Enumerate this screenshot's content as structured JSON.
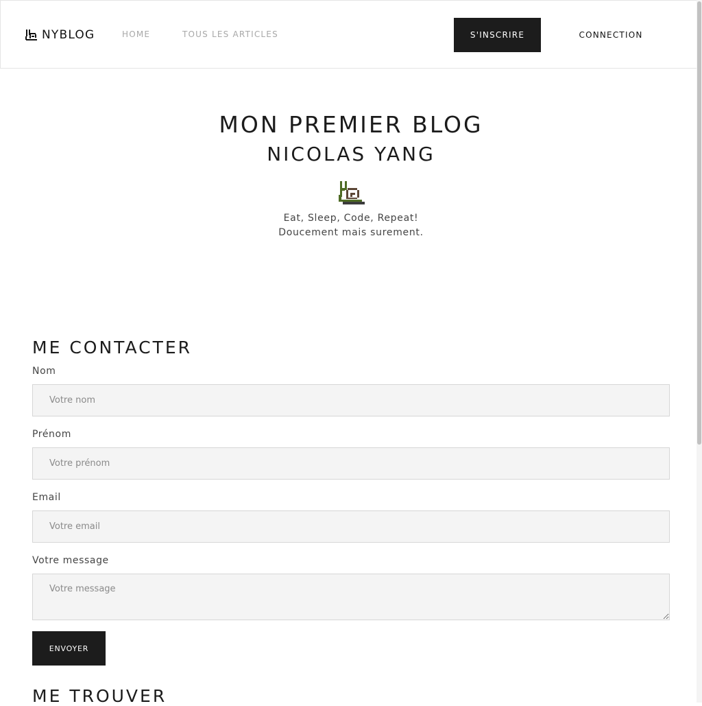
{
  "navbar": {
    "brand_text": "NYBLOG",
    "links": [
      {
        "label": "HOME"
      },
      {
        "label": "TOUS LES ARTICLES"
      }
    ],
    "signup_label": "S'INSCRIRE",
    "login_label": "CONNECTION"
  },
  "hero": {
    "title": "MON PREMIER BLOG",
    "subtitle": "NICOLAS YANG",
    "logo_icon": "snail-icon",
    "tagline_1": "Eat, Sleep, Code, Repeat!",
    "tagline_2": "Doucement mais surement."
  },
  "contact": {
    "title": "ME CONTACTER",
    "fields": [
      {
        "label": "Nom",
        "placeholder": "Votre nom"
      },
      {
        "label": "Prénom",
        "placeholder": "Votre prénom"
      },
      {
        "label": "Email",
        "placeholder": "Votre email"
      },
      {
        "label": "Votre message",
        "placeholder": "Votre message"
      }
    ],
    "submit_label": "ENVOYER"
  },
  "location": {
    "title": "ME TROUVER"
  },
  "colors": {
    "dark_button": "#1c1c1c",
    "nav_link": "#a8a8a8",
    "input_bg": "#f4f4f4",
    "snail_shell": "#5b4636",
    "snail_body": "#4e6b24"
  }
}
